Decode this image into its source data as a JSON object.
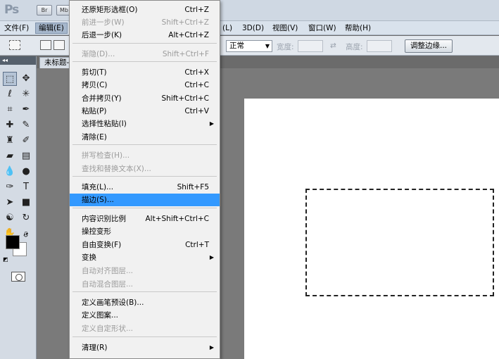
{
  "titlebar": {
    "app_logo": "Ps",
    "bridge_button": "Br",
    "minibridge_button": "Mb"
  },
  "menubar": {
    "file": "文件(F)",
    "edit": "编辑(E)",
    "layer_partial": "(L)",
    "three_d": "3D(D)",
    "view": "视图(V)",
    "window": "窗口(W)",
    "help": "帮助(H)"
  },
  "options": {
    "style_value": "正常",
    "width_label": "宽度:",
    "height_label": "高度:",
    "refine_edge_button": "调整边缘..."
  },
  "document": {
    "tab_title": "未标题-"
  },
  "toolbox": {
    "collapse_label": "◂◂"
  },
  "edit_menu": {
    "items": [
      {
        "label": "还原矩形选框(O)",
        "shortcut": "Ctrl+Z",
        "enabled": true
      },
      {
        "label": "前进一步(W)",
        "shortcut": "Shift+Ctrl+Z",
        "enabled": false
      },
      {
        "label": "后退一步(K)",
        "shortcut": "Alt+Ctrl+Z",
        "enabled": true
      },
      {
        "label": "渐隐(D)...",
        "shortcut": "Shift+Ctrl+F",
        "enabled": false
      },
      {
        "label": "剪切(T)",
        "shortcut": "Ctrl+X",
        "enabled": true
      },
      {
        "label": "拷贝(C)",
        "shortcut": "Ctrl+C",
        "enabled": true
      },
      {
        "label": "合并拷贝(Y)",
        "shortcut": "Shift+Ctrl+C",
        "enabled": true
      },
      {
        "label": "粘贴(P)",
        "shortcut": "Ctrl+V",
        "enabled": true
      },
      {
        "label": "选择性粘贴(I)",
        "shortcut": "",
        "enabled": true,
        "submenu": true
      },
      {
        "label": "清除(E)",
        "shortcut": "",
        "enabled": true
      },
      {
        "label": "拼写检查(H)...",
        "shortcut": "",
        "enabled": false
      },
      {
        "label": "查找和替换文本(X)...",
        "shortcut": "",
        "enabled": false
      },
      {
        "label": "填充(L)...",
        "shortcut": "Shift+F5",
        "enabled": true
      },
      {
        "label": "描边(S)...",
        "shortcut": "",
        "enabled": true,
        "highlighted": true
      },
      {
        "label": "内容识别比例",
        "shortcut": "Alt+Shift+Ctrl+C",
        "enabled": true
      },
      {
        "label": "操控变形",
        "shortcut": "",
        "enabled": true
      },
      {
        "label": "自由变换(F)",
        "shortcut": "Ctrl+T",
        "enabled": true
      },
      {
        "label": "变换",
        "shortcut": "",
        "enabled": true,
        "submenu": true
      },
      {
        "label": "自动对齐图层...",
        "shortcut": "",
        "enabled": false
      },
      {
        "label": "自动混合图层...",
        "shortcut": "",
        "enabled": false
      },
      {
        "label": "定义画笔预设(B)...",
        "shortcut": "",
        "enabled": true
      },
      {
        "label": "定义图案...",
        "shortcut": "",
        "enabled": true
      },
      {
        "label": "定义自定形状...",
        "shortcut": "",
        "enabled": false
      },
      {
        "label": "清理(R)",
        "shortcut": "",
        "enabled": true,
        "submenu": true
      }
    ]
  },
  "colors": {
    "highlight": "#3399ff",
    "disabled_text": "#9b9b9b",
    "foreground_swatch": "#000000",
    "background_swatch": "#ffffff"
  }
}
